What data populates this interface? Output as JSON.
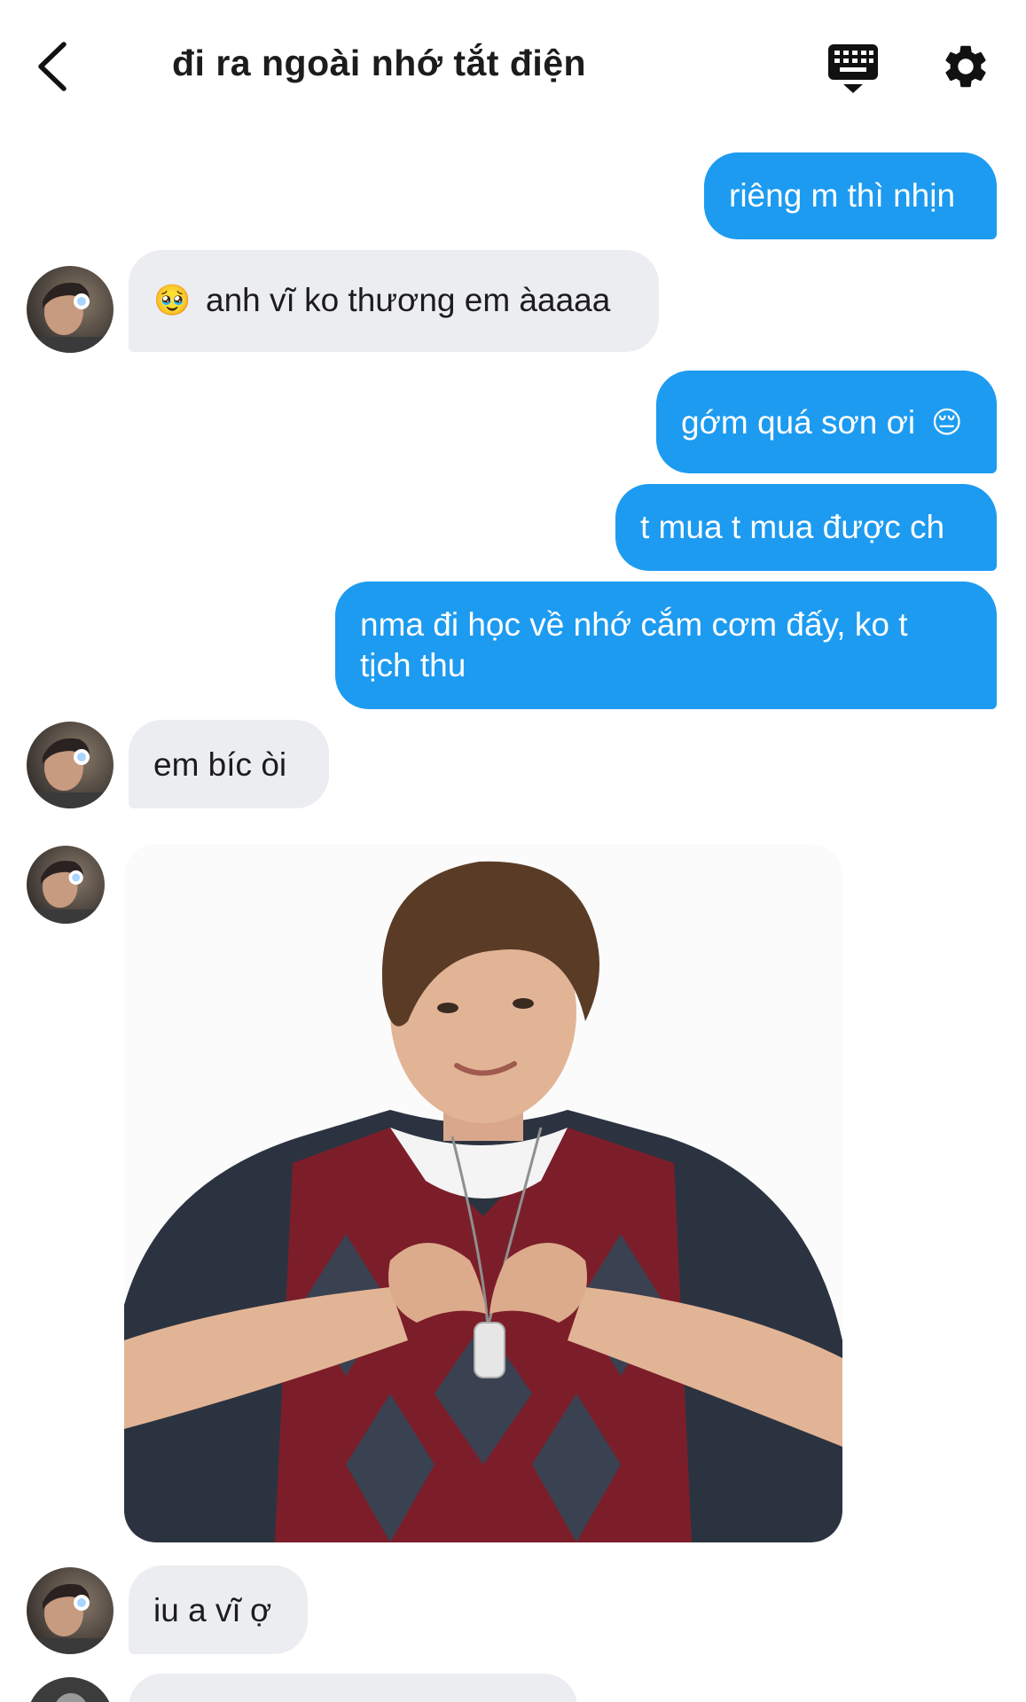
{
  "header": {
    "title": "đi ra ngoài nhớ tắt điện",
    "back_icon": "chevron-left-icon",
    "keyboard_icon": "keyboard-icon",
    "settings_icon": "gear-icon"
  },
  "colors": {
    "outgoing_bubble": "#1d9bf0",
    "incoming_bubble": "#ebedf0",
    "text_dark": "#1c1c1e"
  },
  "messages": [
    {
      "direction": "out",
      "text": "riêng m thì nhịn"
    },
    {
      "direction": "in",
      "emoji": "🥹",
      "text": "anh vĩ ko thương em àaaaa"
    },
    {
      "direction": "out",
      "text": "gớm quá sơn ơi",
      "emoji": "😔"
    },
    {
      "direction": "out",
      "text": "t mua t mua được ch"
    },
    {
      "direction": "out",
      "lines": [
        "nma đi học về nhớ cắm cơm đấy, ko t",
        "tịch thu"
      ]
    },
    {
      "direction": "in",
      "text": "em bíc òi"
    },
    {
      "direction": "in",
      "type": "image",
      "image": "photo-boy-heart-hands"
    },
    {
      "direction": "in",
      "text": "iu a vĩ ợ"
    }
  ]
}
